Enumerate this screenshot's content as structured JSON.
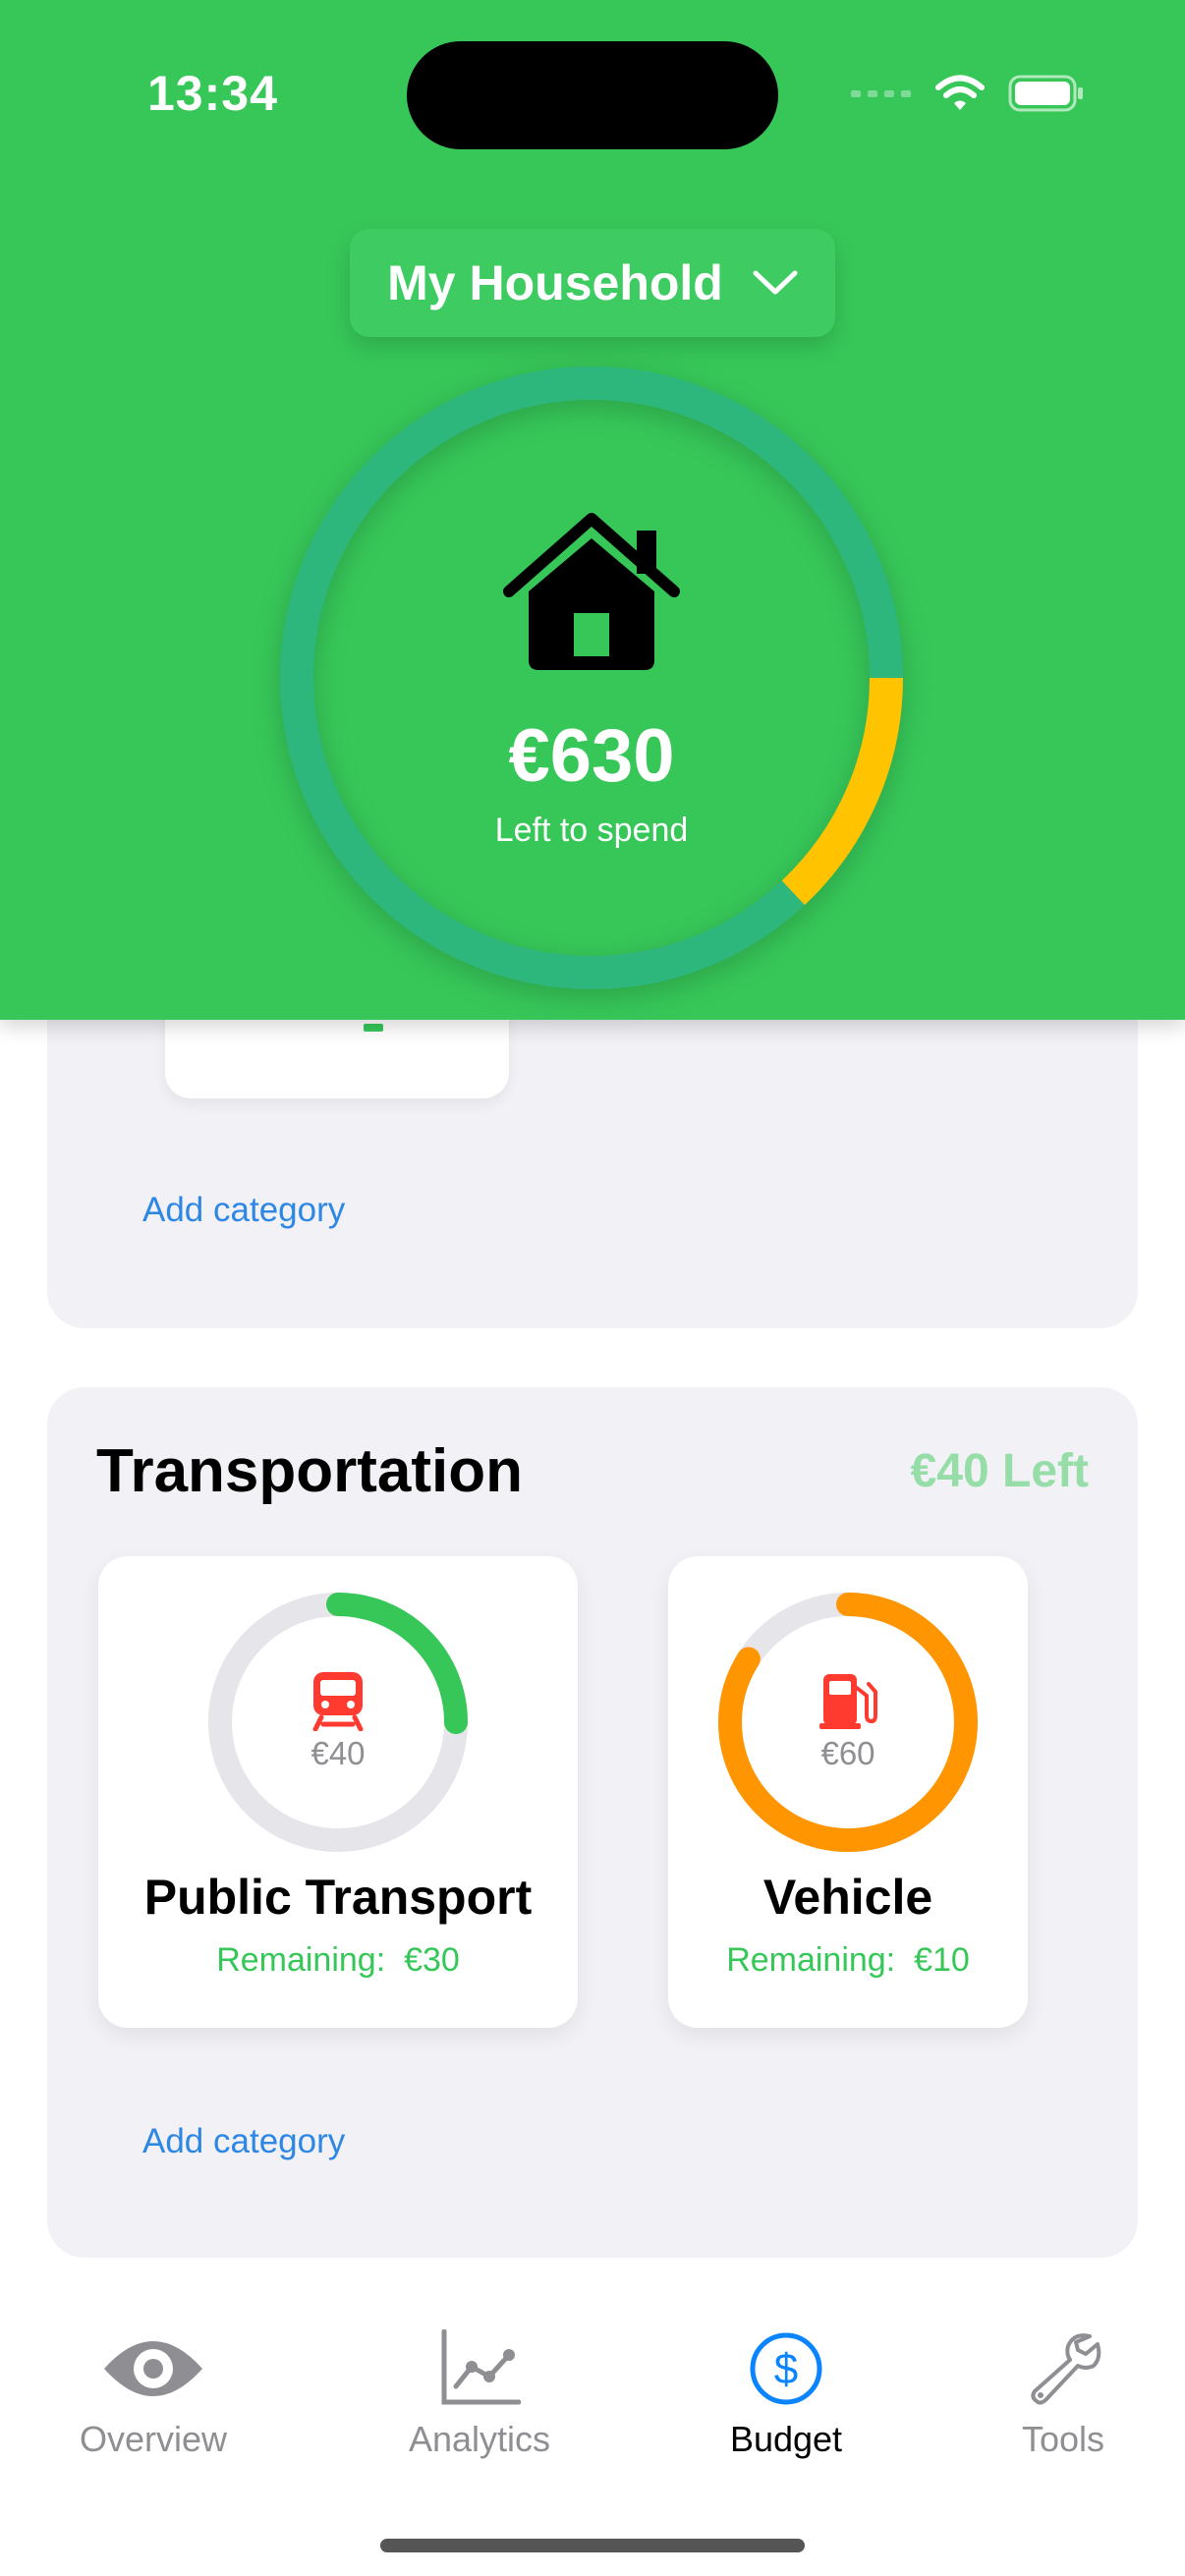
{
  "status_bar": {
    "time": "13:34"
  },
  "header": {
    "household_label": "My Household",
    "amount": "€630",
    "amount_caption": "Left to spend",
    "ring_spent_fraction": 0.13,
    "colors": {
      "background": "#37C759",
      "ring_track": "#2DB77C",
      "ring_spent": "#FFC300"
    }
  },
  "top_card": {
    "add_category": "Add category"
  },
  "transportation": {
    "title": "Transportation",
    "left_label": "€40 Left",
    "add_category": "Add category",
    "categories": [
      {
        "name": "Public Transport",
        "amount": "€40",
        "remaining_label": "Remaining:",
        "remaining_value": "€30",
        "progress": 0.25,
        "progress_color": "#37C759",
        "icon": "train-icon"
      },
      {
        "name": "Vehicle",
        "amount": "€60",
        "remaining_label": "Remaining:",
        "remaining_value": "€10",
        "progress": 0.84,
        "progress_color": "#FF9500",
        "icon": "fuel-pump-icon"
      }
    ]
  },
  "tabbar": {
    "tabs": [
      {
        "label": "Overview",
        "icon": "eye-icon",
        "active": false
      },
      {
        "label": "Analytics",
        "icon": "chart-icon",
        "active": false
      },
      {
        "label": "Budget",
        "icon": "dollar-icon",
        "active": true
      },
      {
        "label": "Tools",
        "icon": "wrench-icon",
        "active": false
      }
    ]
  }
}
